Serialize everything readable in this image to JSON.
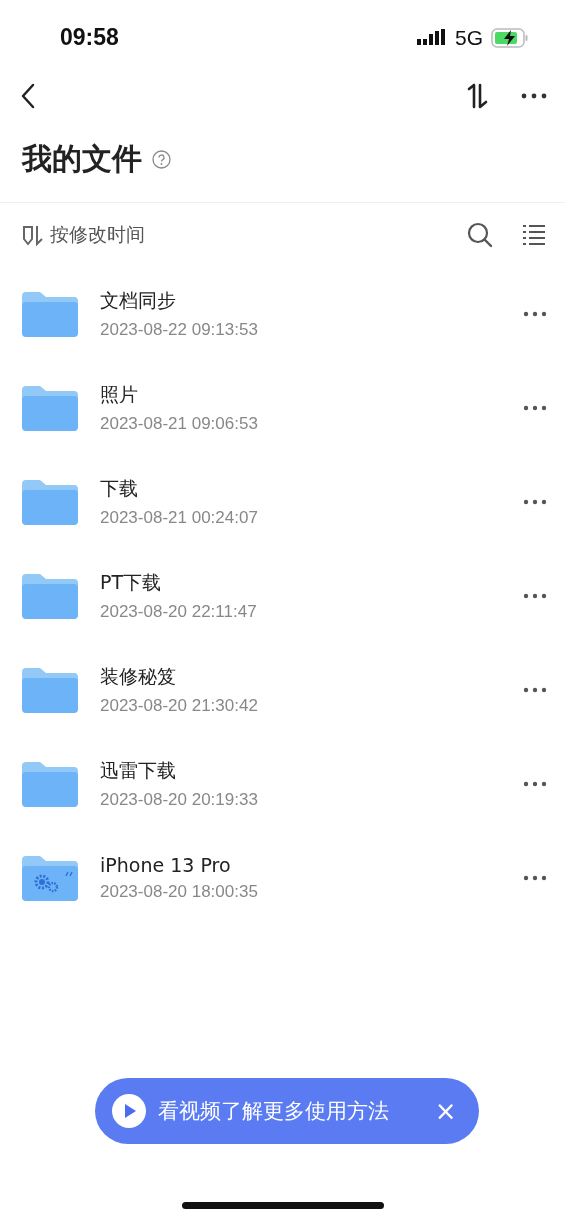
{
  "status_bar": {
    "time": "09:58",
    "network": "5G"
  },
  "title": "我的文件",
  "sort": {
    "label": "按修改时间"
  },
  "files": [
    {
      "name": "文档同步",
      "date": "2023-08-22 09:13:53",
      "kind": "folder"
    },
    {
      "name": "照片",
      "date": "2023-08-21 09:06:53",
      "kind": "folder"
    },
    {
      "name": "下载",
      "date": "2023-08-21 00:24:07",
      "kind": "folder"
    },
    {
      "name": "PT下载",
      "date": "2023-08-20 22:11:47",
      "kind": "folder"
    },
    {
      "name": "装修秘笈",
      "date": "2023-08-20 21:30:42",
      "kind": "folder"
    },
    {
      "name": "迅雷下载",
      "date": "2023-08-20 20:19:33",
      "kind": "folder"
    },
    {
      "name": "iPhone 13 Pro",
      "date": "2023-08-20 18:00:35",
      "kind": "device"
    }
  ],
  "banner": {
    "text": "看视频了解更多使用方法",
    "close": "×"
  }
}
